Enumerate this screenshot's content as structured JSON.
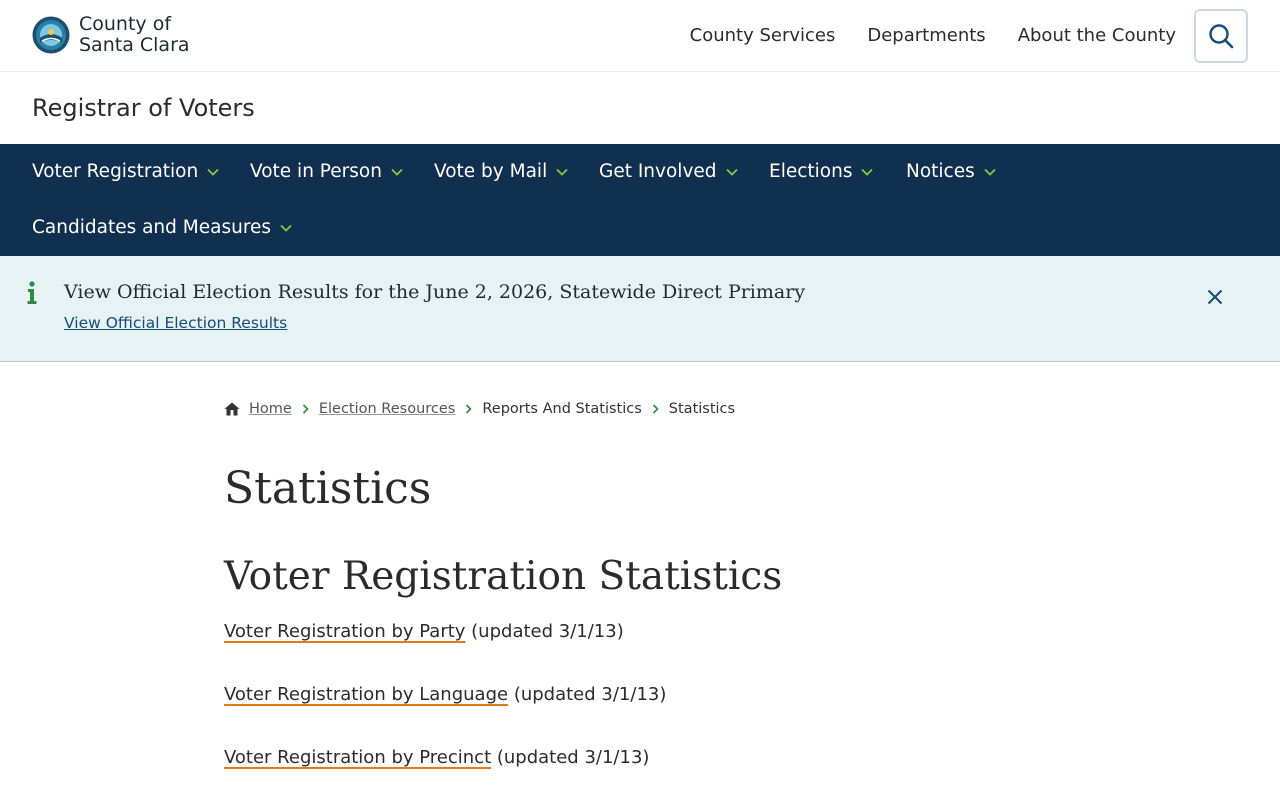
{
  "header": {
    "logo": {
      "line1": "County of",
      "line2": "Santa Clara"
    },
    "nav": [
      "County Services",
      "Departments",
      "About the County"
    ]
  },
  "department": {
    "title": "Registrar of Voters"
  },
  "main_nav": {
    "items": [
      "Voter Registration",
      "Vote in Person",
      "Vote by Mail",
      "Get Involved",
      "Elections",
      "Notices",
      "Candidates and Measures"
    ]
  },
  "alert": {
    "title": "View Official Election Results for the June 2, 2026, Statewide Direct Primary",
    "link": "View Official Election Results"
  },
  "breadcrumb": {
    "home": "Home",
    "items": [
      "Election Resources",
      "Reports And Statistics",
      "Statistics"
    ]
  },
  "page": {
    "title": "Statistics",
    "section_title": "Voter Registration Statistics",
    "stats": [
      {
        "link": "Voter Registration by Party",
        "note": " (updated 3/1/13)"
      },
      {
        "link": "Voter Registration by Language",
        "note": " (updated 3/1/13)"
      },
      {
        "link": "Voter Registration by Precinct",
        "note": " (updated 3/1/13)"
      }
    ]
  },
  "colors": {
    "nav_bg": "#11304f",
    "chevron": "#8cc63f",
    "alert_bg": "#e6f2f4",
    "info_icon": "#2e8b3d",
    "link_underline": "#e07a14"
  }
}
